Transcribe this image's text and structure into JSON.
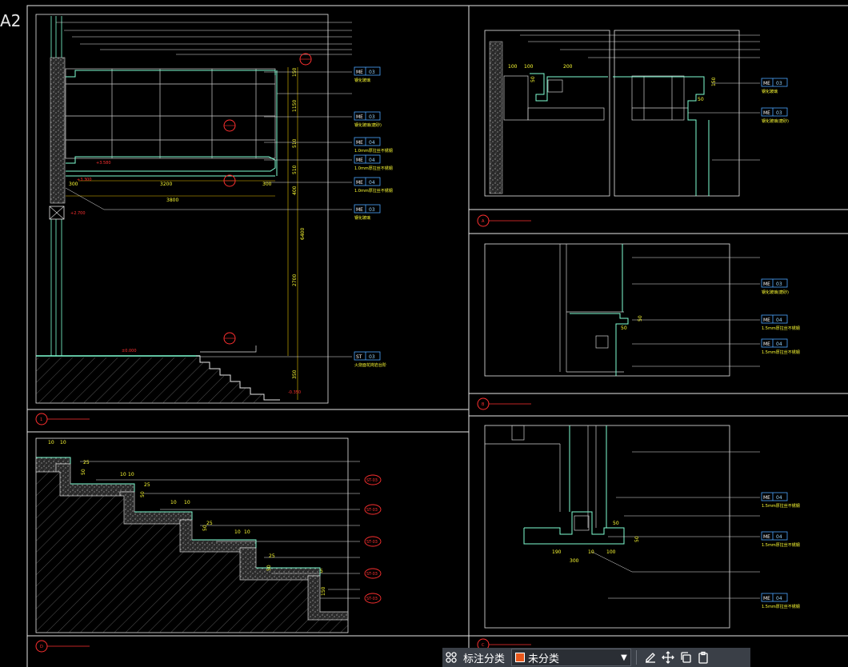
{
  "sheet": {
    "label": "A2"
  },
  "toolbar": {
    "category_label": "标注分类",
    "category_value": "未分类",
    "swatch_color": "#e8581c"
  },
  "colors": {
    "frame": "#e6e6e6",
    "structure": "#7fffd4",
    "annotation": "#ffff33",
    "section_mark": "#ff3030",
    "tag_outline": "#4da6ff"
  },
  "main_section": {
    "dims_bottom": [
      "300",
      "3200",
      "300",
      "3800"
    ],
    "dims_right": [
      "150",
      "1150",
      "510",
      "510",
      "400",
      "2700",
      "350",
      "6400"
    ],
    "levels": [
      "+3.300",
      "+3.580",
      "+2.700",
      "±0.000",
      "-0.350"
    ],
    "tags": [
      {
        "code": "ME",
        "num": "03",
        "desc": "钢化玻璃"
      },
      {
        "code": "ME",
        "num": "03",
        "desc": "钢化玻璃(磨砂)"
      },
      {
        "code": "ME",
        "num": "04",
        "desc": "1.0mm厚拉丝不锈钢"
      },
      {
        "code": "ME",
        "num": "04",
        "desc": "1.0mm厚拉丝不锈钢"
      },
      {
        "code": "ME",
        "num": "04",
        "desc": "1.0mm厚拉丝不锈钢"
      },
      {
        "code": "ME",
        "num": "03",
        "desc": "钢化玻璃"
      },
      {
        "code": "ST",
        "num": "03",
        "desc": "火烧面花岗岩台阶"
      }
    ],
    "title_marker": "1"
  },
  "stair_detail": {
    "dims": [
      "10",
      "10",
      "25",
      "50",
      "10",
      "10",
      "25",
      "50",
      "10",
      "10",
      "25",
      "50",
      "10",
      "10",
      "25",
      "50",
      "5",
      "150"
    ],
    "tags": [
      "ST-03",
      "ST-03",
      "ST-03",
      "ST-03",
      "ST-03",
      "ST-03"
    ],
    "title_marker": "D"
  },
  "detail_a": {
    "dims": [
      "100",
      "100",
      "200",
      "50",
      "150",
      "50"
    ],
    "tags": [
      {
        "code": "ME",
        "num": "03",
        "desc": "钢化玻璃"
      },
      {
        "code": "ME",
        "num": "03",
        "desc": "钢化玻璃(磨砂)"
      }
    ],
    "title_marker": "A"
  },
  "detail_b": {
    "dims": [
      "50",
      "50"
    ],
    "tags": [
      {
        "code": "ME",
        "num": "03",
        "desc": "钢化玻璃(磨砂)"
      },
      {
        "code": "ME",
        "num": "04",
        "desc": "1.5mm厚拉丝不锈钢"
      },
      {
        "code": "ME",
        "num": "04",
        "desc": "1.5mm厚拉丝不锈钢"
      }
    ],
    "title_marker": "B"
  },
  "detail_c": {
    "dims": [
      "50",
      "50",
      "190",
      "10",
      "100",
      "300"
    ],
    "tags": [
      {
        "code": "ME",
        "num": "04",
        "desc": "1.5mm厚拉丝不锈钢"
      },
      {
        "code": "ME",
        "num": "04",
        "desc": "1.5mm厚拉丝不锈钢"
      },
      {
        "code": "ME",
        "num": "04",
        "desc": "1.5mm厚拉丝不锈钢"
      }
    ],
    "title_marker": "C"
  }
}
